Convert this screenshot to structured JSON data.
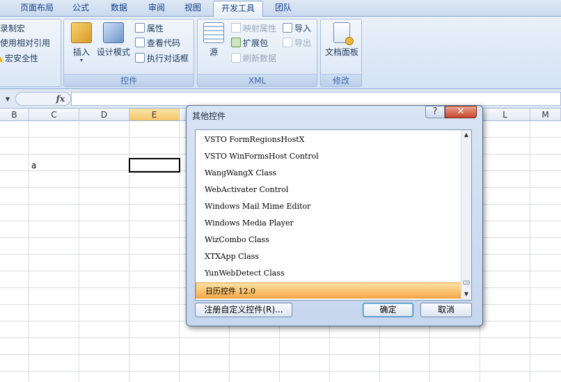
{
  "ribbon_tabs": {
    "page_layout": "页面布局",
    "formulas": "公式",
    "data": "数据",
    "review": "审阅",
    "view": "视图",
    "developer": "开发工具",
    "team": "团队"
  },
  "code_group": {
    "record_macro": "录制宏",
    "relative_refs": "使用相对引用",
    "macro_security": "宏安全性"
  },
  "controls_group": {
    "label": "控件",
    "insert": "插入",
    "design_mode": "设计模式",
    "properties": "属性",
    "view_code": "查看代码",
    "run_dialog": "执行对话框"
  },
  "xml_group": {
    "label": "XML",
    "source": "源",
    "map_properties": "映射属性",
    "expansion_packs": "扩展包",
    "refresh_data": "刷新数据",
    "import": "导入",
    "export": "导出"
  },
  "modify_group": {
    "label": "修改",
    "document_panel": "文档面板"
  },
  "formula_bar": {
    "fx": "fx"
  },
  "columns": [
    "B",
    "C",
    "D",
    "E",
    "L",
    "M"
  ],
  "cells": {
    "c_value": "a"
  },
  "dialog": {
    "title": "其他控件",
    "help": "?",
    "items": [
      "VSTO FormRegionsHostX",
      "VSTO WinFormsHost Control",
      "WangWangX Class",
      "WebActivater Control",
      "Windows Mail Mime Editor",
      "Windows Media Player",
      "WizCombo Class",
      "XTXApp Class",
      "YunWebDetect Class",
      "日历控件 12.0"
    ],
    "register_button": "注册自定义控件(R)...",
    "ok_button": "确定",
    "cancel_button": "取消"
  },
  "colors": {
    "ribbon_bg": "#dbe7f5",
    "selected_item": "#f7a94a",
    "selected_column": "#f5c66a",
    "close_button": "#c8452a"
  }
}
